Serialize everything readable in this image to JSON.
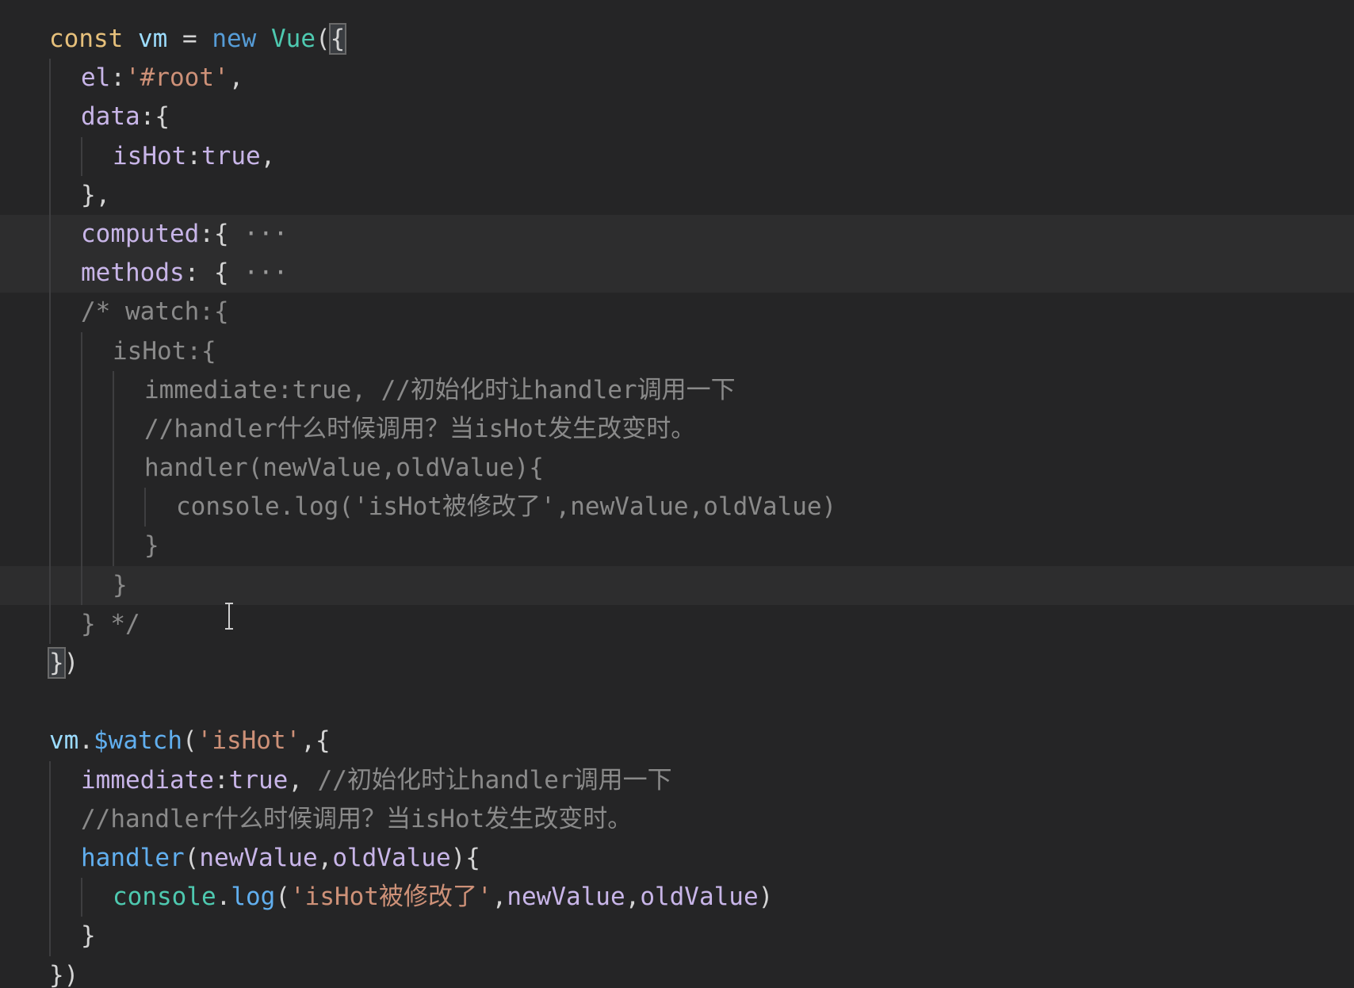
{
  "editor": {
    "lines": [
      [
        {
          "t": "const",
          "c": "t-keyword"
        },
        {
          "t": " ",
          "c": "t-punc"
        },
        {
          "t": "vm",
          "c": "t-var"
        },
        {
          "t": " = ",
          "c": "t-punc"
        },
        {
          "t": "new",
          "c": "t-new"
        },
        {
          "t": " ",
          "c": "t-punc"
        },
        {
          "t": "Vue",
          "c": "t-cls"
        },
        {
          "t": "(",
          "c": "t-paren"
        },
        {
          "t": "{",
          "c": "t-paren bracket-box"
        }
      ],
      [
        {
          "t": "el",
          "c": "t-prop"
        },
        {
          "t": ":",
          "c": "t-punc"
        },
        {
          "t": "'#root'",
          "c": "t-str"
        },
        {
          "t": ",",
          "c": "t-punc"
        }
      ],
      [
        {
          "t": "data",
          "c": "t-prop"
        },
        {
          "t": ":{",
          "c": "t-punc"
        }
      ],
      [
        {
          "t": "isHot",
          "c": "t-prop"
        },
        {
          "t": ":",
          "c": "t-punc"
        },
        {
          "t": "true",
          "c": "t-bool"
        },
        {
          "t": ",",
          "c": "t-punc"
        }
      ],
      [
        {
          "t": "},",
          "c": "t-punc"
        }
      ],
      [
        {
          "t": "computed",
          "c": "t-prop"
        },
        {
          "t": ":{ ",
          "c": "t-punc"
        },
        {
          "t": "···",
          "c": "ellipsis"
        }
      ],
      [
        {
          "t": "methods",
          "c": "t-prop"
        },
        {
          "t": ": { ",
          "c": "t-punc"
        },
        {
          "t": "···",
          "c": "ellipsis"
        }
      ],
      [
        {
          "t": "/* watch:{",
          "c": "t-dim"
        }
      ],
      [
        {
          "t": "isHot:{",
          "c": "t-dim"
        }
      ],
      [
        {
          "t": "immediate:true, //初始化时让handler调用一下",
          "c": "t-dim"
        }
      ],
      [
        {
          "t": "//handler什么时候调用？当isHot发生改变时。",
          "c": "t-dim"
        }
      ],
      [
        {
          "t": "handler(newValue,oldValue){",
          "c": "t-dim"
        }
      ],
      [
        {
          "t": "console.log('isHot被修改了',newValue,oldValue)",
          "c": "t-dim"
        }
      ],
      [
        {
          "t": "}",
          "c": "t-dim"
        }
      ],
      [
        {
          "t": "}",
          "c": "t-dim"
        }
      ],
      [
        {
          "t": "} */",
          "c": "t-dim"
        }
      ],
      [
        {
          "t": "}",
          "c": "t-paren bracket-box"
        },
        {
          "t": ")",
          "c": "t-paren"
        }
      ],
      [],
      [
        {
          "t": "vm",
          "c": "t-vm"
        },
        {
          "t": ".",
          "c": "t-punc"
        },
        {
          "t": "$watch",
          "c": "t-func"
        },
        {
          "t": "(",
          "c": "t-paren"
        },
        {
          "t": "'isHot'",
          "c": "t-strg"
        },
        {
          "t": ",{",
          "c": "t-punc"
        }
      ],
      [
        {
          "t": "immediate",
          "c": "t-prop"
        },
        {
          "t": ":",
          "c": "t-punc"
        },
        {
          "t": "true",
          "c": "t-bool"
        },
        {
          "t": ", ",
          "c": "t-punc"
        },
        {
          "t": "//初始化时让handler调用一下",
          "c": "t-comment"
        }
      ],
      [
        {
          "t": "//handler什么时候调用？当isHot发生改变时。",
          "c": "t-comment"
        }
      ],
      [
        {
          "t": "handler",
          "c": "t-func"
        },
        {
          "t": "(",
          "c": "t-paren"
        },
        {
          "t": "newValue",
          "c": "t-param"
        },
        {
          "t": ",",
          "c": "t-punc"
        },
        {
          "t": "oldValue",
          "c": "t-param"
        },
        {
          "t": "){",
          "c": "t-paren"
        }
      ],
      [
        {
          "t": "console",
          "c": "t-console"
        },
        {
          "t": ".",
          "c": "t-punc"
        },
        {
          "t": "log",
          "c": "t-func"
        },
        {
          "t": "(",
          "c": "t-paren"
        },
        {
          "t": "'isHot被修改了'",
          "c": "t-strg"
        },
        {
          "t": ",",
          "c": "t-punc"
        },
        {
          "t": "newValue",
          "c": "t-param"
        },
        {
          "t": ",",
          "c": "t-punc"
        },
        {
          "t": "oldValue",
          "c": "t-param"
        },
        {
          "t": ")",
          "c": "t-paren"
        }
      ],
      [
        {
          "t": "}",
          "c": "t-punc"
        }
      ],
      [
        {
          "t": "})",
          "c": "t-punc"
        }
      ]
    ]
  }
}
